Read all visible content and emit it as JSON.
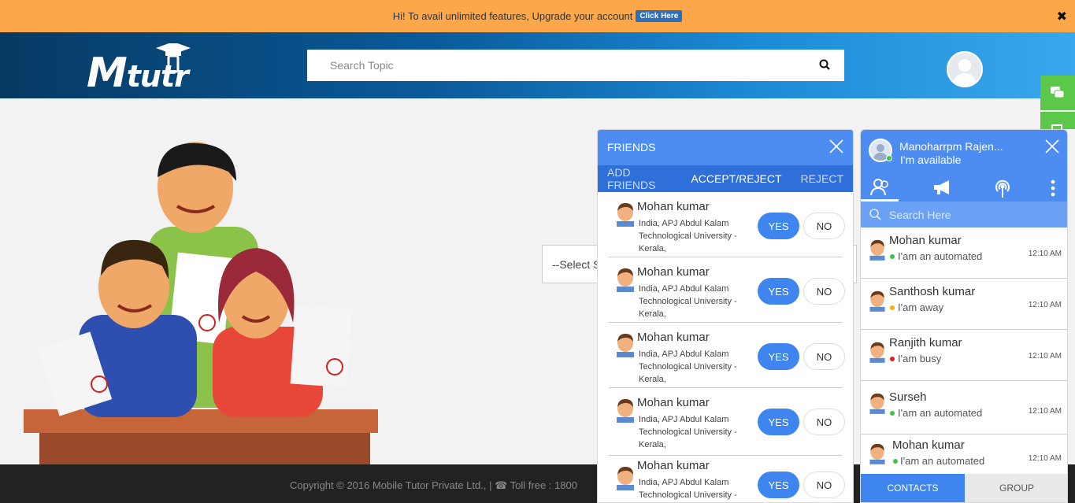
{
  "promo": {
    "text": "Hi! To avail unlimited features, Upgrade your account",
    "cta": "Click Here",
    "close": "✖"
  },
  "header": {
    "logo_text": "tutr",
    "logo_m": "M",
    "search_placeholder": "Search Topic"
  },
  "main": {
    "select_text": "--Select S"
  },
  "footer": {
    "text": "Copyright © 2016 Mobile Tutor Private Ltd., | ☎ Toll free : 1800"
  },
  "friends": {
    "title": "FRIENDS",
    "tabs": [
      "ADD FRIENDS",
      "ACCEPT/REJECT",
      "REJECT"
    ],
    "yes_label": "YES",
    "no_label": "NO",
    "requests": [
      {
        "name": "Mohan kumar",
        "address": "India, APJ Abdul Kalam Technological University - Kerala,"
      },
      {
        "name": "Mohan kumar",
        "address": "India, APJ Abdul Kalam Technological University - Kerala,"
      },
      {
        "name": "Mohan kumar",
        "address": "India, APJ Abdul Kalam Technological University - Kerala,"
      },
      {
        "name": "Mohan kumar",
        "address": "India, APJ Abdul Kalam Technological University - Kerala,"
      },
      {
        "name": "Mohan kumar",
        "address": "India, APJ Abdul Kalam Technological University -"
      }
    ]
  },
  "chat": {
    "user_name": "Manoharrpm Rajen...",
    "user_status": "I'm available",
    "search_placeholder": "Search Here",
    "contacts": [
      {
        "name": "Mohan kumar",
        "status": "I'am an automated",
        "time": "12:10 AM",
        "dot": "#3ac24a"
      },
      {
        "name": "Santhosh kumar",
        "status": "I'am away",
        "time": "12:10 AM",
        "dot": "#f0b400"
      },
      {
        "name": "Ranjith kumar",
        "status": "I'am busy",
        "time": "12:10 AM",
        "dot": "#e02020"
      },
      {
        "name": "Surseh",
        "status": "I'am an automated",
        "time": "12:10 AM",
        "dot": "#3ac24a"
      },
      {
        "name": "Mohan kumar",
        "status": "I'am an automated",
        "time": "12:10 AM",
        "dot": "#3ac24a"
      }
    ],
    "tab_contacts": "CONTACTS",
    "tab_group": "GROUP"
  }
}
